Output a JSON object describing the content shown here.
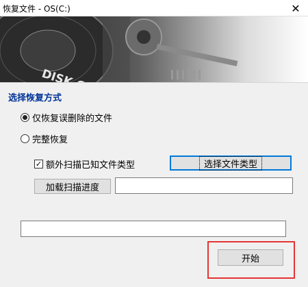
{
  "window": {
    "title": "恢复文件 - OS(C:)",
    "close_symbol": "✕"
  },
  "banner": {
    "logo_text": "DISK GENIUS"
  },
  "recovery_mode": {
    "section_title": "选择恢复方式",
    "option_deleted_only": "仅恢复误删除的文件",
    "option_full": "完整恢复",
    "selected": "option_deleted_only"
  },
  "scan_options": {
    "extra_scan_label": "额外扫描已知文件类型",
    "extra_scan_checked": true,
    "check_mark": "✓",
    "select_types_button": "选择文件类型",
    "load_progress_button": "加载扫描进度",
    "progress_path_value": ""
  },
  "status": {
    "status_field_value": ""
  },
  "actions": {
    "start_button": "开始"
  }
}
